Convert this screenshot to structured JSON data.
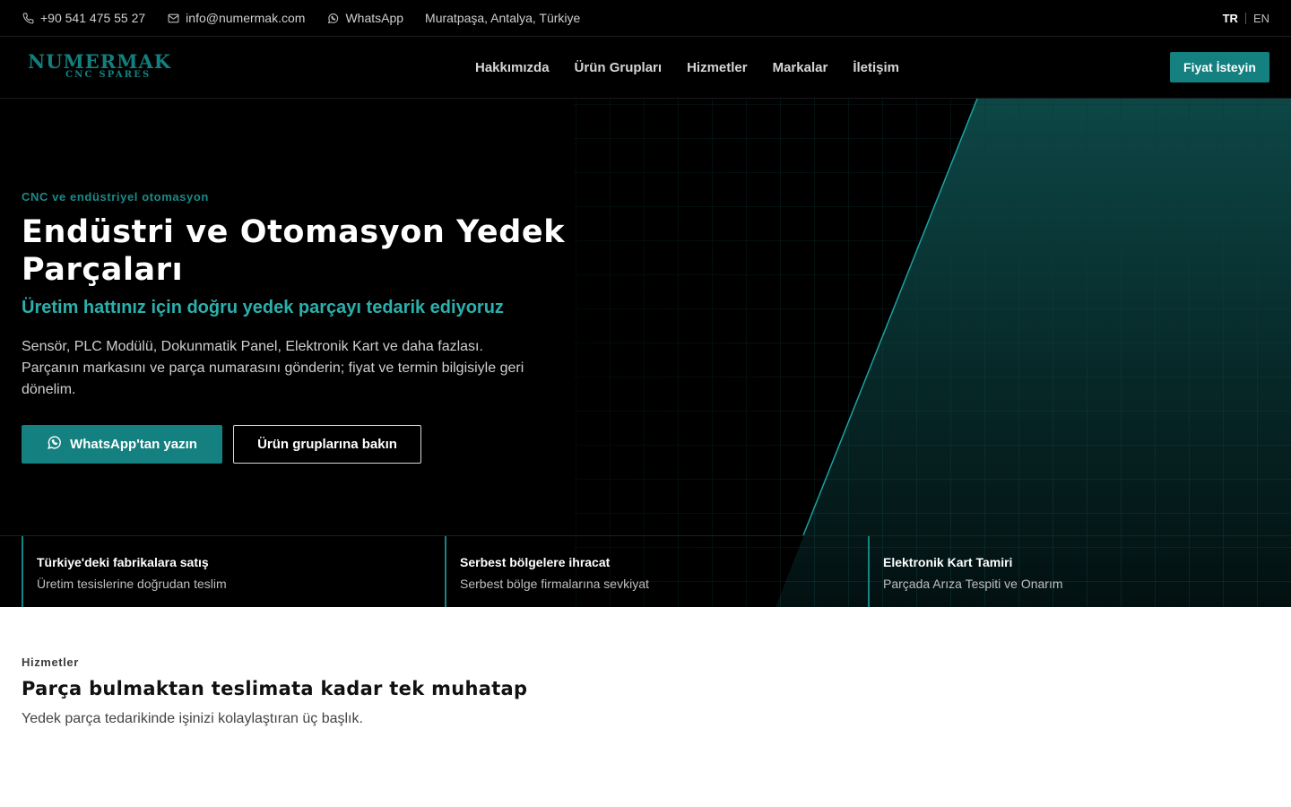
{
  "topbar": {
    "phone": "+90 541 475 55 27",
    "email": "info@numermak.com",
    "whatsapp": "WhatsApp",
    "location": "Muratpaşa, Antalya, Türkiye",
    "lang_tr": "TR",
    "lang_en": "EN"
  },
  "brand": {
    "name": "NUMERMAK",
    "tagline": "CNC SPARES",
    "color": "#12807e"
  },
  "nav": {
    "items": [
      "Hakkımızda",
      "Ürün Grupları",
      "Hizmetler",
      "Markalar",
      "İletişim"
    ],
    "cta": "Fiyat İsteyin"
  },
  "hero": {
    "eyebrow": "CNC ve endüstriyel otomasyon",
    "title": "Endüstri ve Otomasyon Yedek Parçaları",
    "subtitle": "Üretim hattınız için doğru yedek parçayı tedarik ediyoruz",
    "description": "Sensör, PLC Modülü, Dokunmatik Panel, Elektronik Kart ve daha fazlası. Parçanın markasını ve parça numarasını gönderin; fiyat ve termin bilgisiyle geri dönelim.",
    "primary_button": "WhatsApp'tan yazın",
    "secondary_button": "Ürün gruplarına bakın",
    "accent": "#14807f"
  },
  "features": [
    {
      "title": "Türkiye'deki fabrikalara satış",
      "text": "Üretim tesislerine doğrudan teslim"
    },
    {
      "title": "Serbest bölgelere ihracat",
      "text": "Serbest bölge firmalarına sevkiyat"
    },
    {
      "title": "Elektronik Kart Tamiri",
      "text": "Parçada Arıza Tespiti ve Onarım"
    }
  ],
  "services": {
    "label": "Hizmetler",
    "title": "Parça bulmaktan teslimata kadar tek muhatap",
    "text": "Yedek parça tedarikinde işinizi kolaylaştıran üç başlık."
  },
  "icons": [
    "phone-icon",
    "mail-icon",
    "whatsapp-icon"
  ]
}
